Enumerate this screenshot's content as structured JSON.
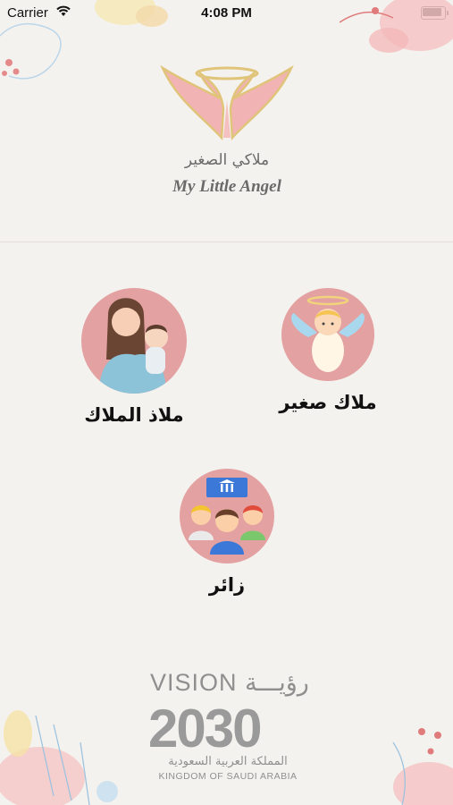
{
  "status_bar": {
    "carrier": "Carrier",
    "time": "4:08 PM"
  },
  "logo": {
    "arabic": "ملاكي الصغير",
    "english": "My Little Angel",
    "icon": "angel-wings-halo-icon"
  },
  "options": [
    {
      "label": "ملاك صغير",
      "icon": "cherub-angel-icon"
    },
    {
      "label": "ملاذ الملاك",
      "icon": "mother-with-baby-icon"
    },
    {
      "label": "زائر",
      "icon": "visitors-group-icon"
    }
  ],
  "vision": {
    "top": "VISION رؤيـــة",
    "year": "2030",
    "arabic": "المملكة العربية السعودية",
    "english": "KINGDOM OF SAUDI ARABIA"
  },
  "colors": {
    "background": "#f4f2ee",
    "circle": "#e3a1a1",
    "wings": "#f1b3b3",
    "halo": "#e0c47a"
  }
}
